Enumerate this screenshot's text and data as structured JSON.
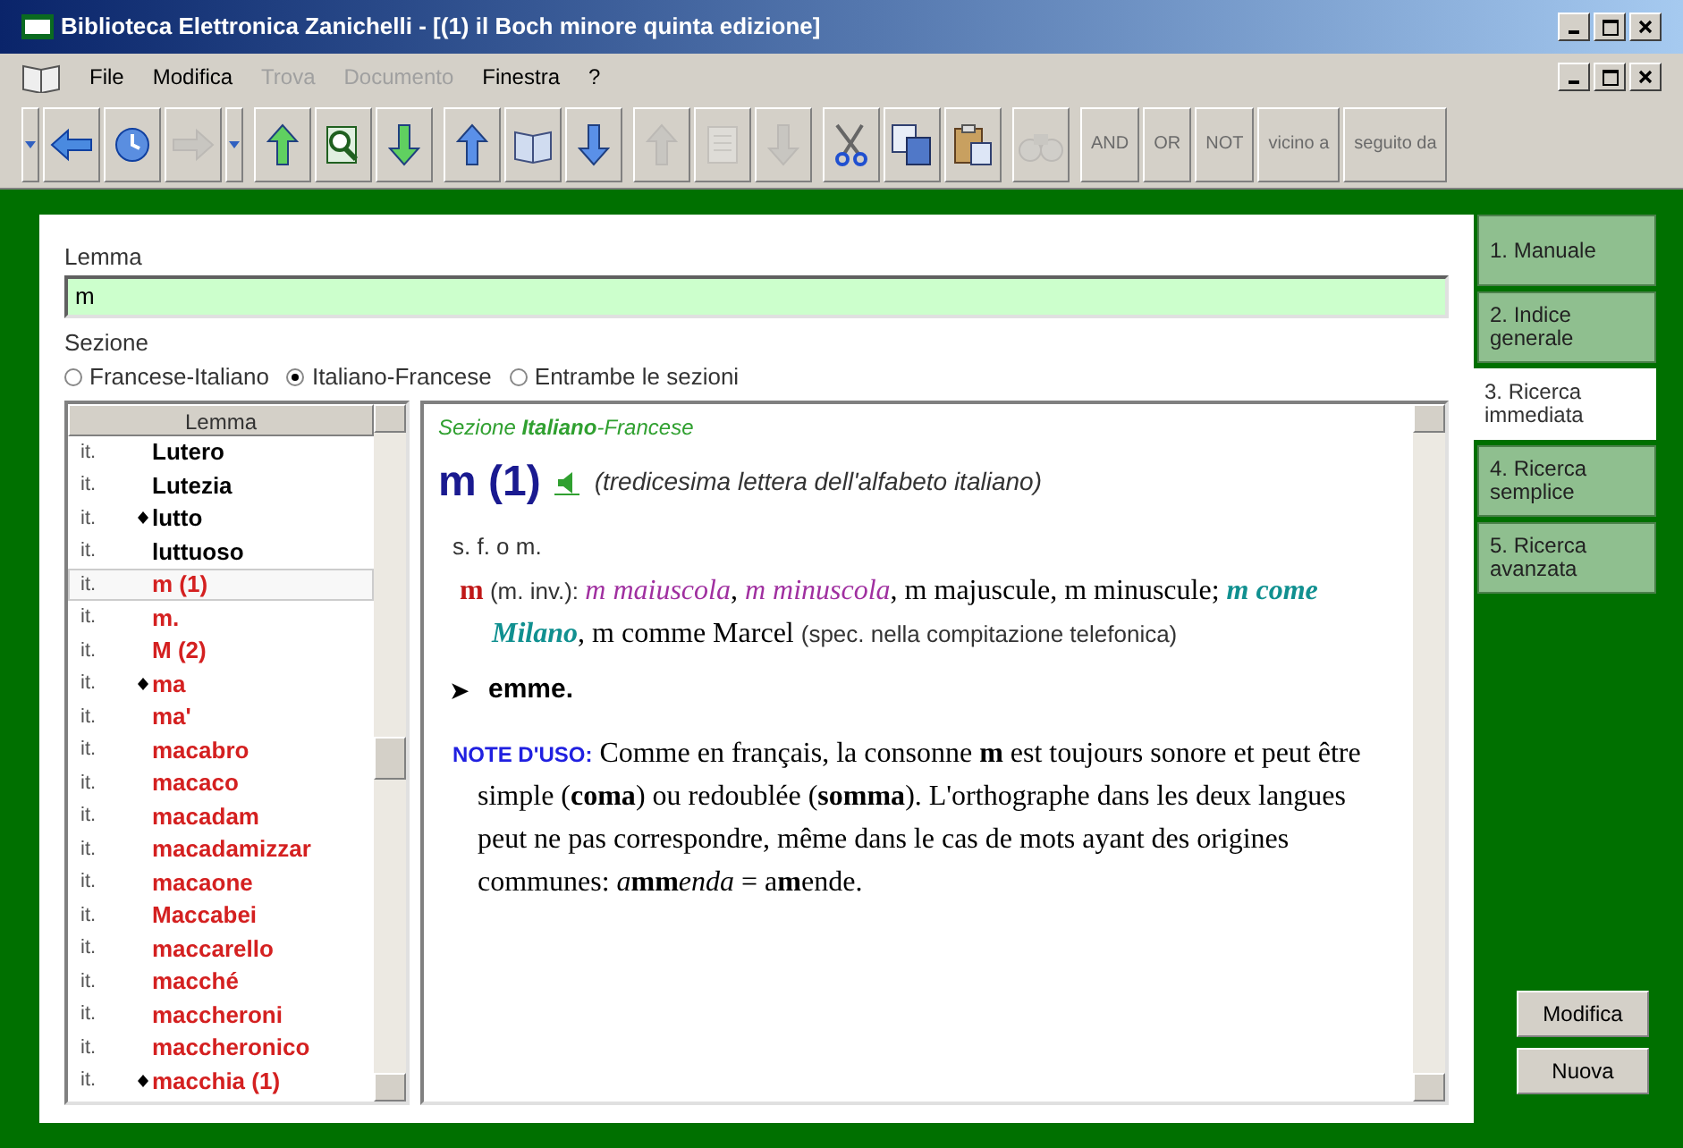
{
  "window": {
    "title": "Biblioteca Elettronica Zanichelli - [(1) il Boch minore quinta edizione]"
  },
  "menu": [
    {
      "label": "File",
      "disabled": false
    },
    {
      "label": "Modifica",
      "disabled": false
    },
    {
      "label": "Trova",
      "disabled": true
    },
    {
      "label": "Documento",
      "disabled": true
    },
    {
      "label": "Finestra",
      "disabled": false
    },
    {
      "label": "?",
      "disabled": false
    }
  ],
  "toolbar": {
    "groups": [
      [
        {
          "kind": "caret",
          "disabled": false
        },
        {
          "kind": "back",
          "disabled": false
        },
        {
          "kind": "history",
          "disabled": false
        },
        {
          "kind": "forward",
          "disabled": true
        },
        {
          "kind": "caret",
          "disabled": false
        }
      ],
      [
        {
          "kind": "up",
          "disabled": false
        },
        {
          "kind": "find",
          "disabled": false
        },
        {
          "kind": "down",
          "disabled": false
        }
      ],
      [
        {
          "kind": "up",
          "disabled": false
        },
        {
          "kind": "book",
          "disabled": false
        },
        {
          "kind": "down",
          "disabled": false
        }
      ],
      [
        {
          "kind": "up",
          "disabled": true
        },
        {
          "kind": "page",
          "disabled": true
        },
        {
          "kind": "down",
          "disabled": true
        }
      ],
      [
        {
          "kind": "cut",
          "disabled": false
        },
        {
          "kind": "copy",
          "disabled": false
        },
        {
          "kind": "paste",
          "disabled": false
        }
      ],
      [
        {
          "kind": "binoculars",
          "disabled": true
        }
      ]
    ],
    "operators": [
      {
        "label": "AND",
        "disabled": true
      },
      {
        "label": "OR",
        "disabled": true
      },
      {
        "label": "NOT",
        "disabled": true
      },
      {
        "label": "vicino a",
        "disabled": true
      },
      {
        "label": "seguito da",
        "disabled": true
      }
    ]
  },
  "search": {
    "label": "Lemma",
    "value": "m"
  },
  "section": {
    "label": "Sezione",
    "options": [
      {
        "label": "Francese-Italiano",
        "selected": false
      },
      {
        "label": "Italiano-Francese",
        "selected": true
      },
      {
        "label": "Entrambe le sezioni",
        "selected": false
      }
    ]
  },
  "lemma_list": {
    "header": "Lemma",
    "rows": [
      {
        "lang": "it.",
        "word": "Lutero",
        "marker": false,
        "color": "#000000",
        "selected": false
      },
      {
        "lang": "it.",
        "word": "Lutezia",
        "marker": false,
        "color": "#000000",
        "selected": false
      },
      {
        "lang": "it.",
        "word": "lutto",
        "marker": true,
        "color": "#000000",
        "selected": false
      },
      {
        "lang": "it.",
        "word": "luttuoso",
        "marker": false,
        "color": "#000000",
        "selected": false
      },
      {
        "lang": "it.",
        "word": "m (1)",
        "marker": false,
        "color": "#d42020",
        "selected": true
      },
      {
        "lang": "it.",
        "word": "m.",
        "marker": false,
        "color": "#d42020",
        "selected": false
      },
      {
        "lang": "it.",
        "word": "M (2)",
        "marker": false,
        "color": "#d42020",
        "selected": false
      },
      {
        "lang": "it.",
        "word": "ma",
        "marker": true,
        "color": "#d42020",
        "selected": false
      },
      {
        "lang": "it.",
        "word": "ma'",
        "marker": false,
        "color": "#d42020",
        "selected": false
      },
      {
        "lang": "it.",
        "word": "macabro",
        "marker": false,
        "color": "#d42020",
        "selected": false
      },
      {
        "lang": "it.",
        "word": "macaco",
        "marker": false,
        "color": "#d42020",
        "selected": false
      },
      {
        "lang": "it.",
        "word": "macadam",
        "marker": false,
        "color": "#d42020",
        "selected": false
      },
      {
        "lang": "it.",
        "word": "macadamizzar",
        "marker": false,
        "color": "#d42020",
        "selected": false
      },
      {
        "lang": "it.",
        "word": "macaone",
        "marker": false,
        "color": "#d42020",
        "selected": false
      },
      {
        "lang": "it.",
        "word": "Maccabei",
        "marker": false,
        "color": "#d42020",
        "selected": false
      },
      {
        "lang": "it.",
        "word": "maccarello",
        "marker": false,
        "color": "#d42020",
        "selected": false
      },
      {
        "lang": "it.",
        "word": "macché",
        "marker": false,
        "color": "#d42020",
        "selected": false
      },
      {
        "lang": "it.",
        "word": "maccheroni",
        "marker": false,
        "color": "#d42020",
        "selected": false
      },
      {
        "lang": "it.",
        "word": "maccheronico",
        "marker": false,
        "color": "#d42020",
        "selected": false
      },
      {
        "lang": "it.",
        "word": "macchia (1)",
        "marker": true,
        "color": "#d42020",
        "selected": false
      }
    ]
  },
  "entry": {
    "section": "Sezione **Italiano**-Francese",
    "headword": "m (1)",
    "gloss": "(tredicesima lettera dell'alfabeto italiano)",
    "grammar": "s. f. o m.",
    "sense": [
      {
        "kind": "head",
        "text": "m"
      },
      {
        "kind": "label",
        "text": " (m. inv.): "
      },
      {
        "kind": "example",
        "text": "m maiuscola"
      },
      {
        "kind": "serif",
        "text": ", "
      },
      {
        "kind": "example",
        "text": "m minuscola"
      },
      {
        "kind": "serif",
        "text": ", m majuscule, m minuscule; "
      },
      {
        "kind": "phrase",
        "text": "m come Milano"
      },
      {
        "kind": "serif",
        "text": ", m comme Marcel "
      },
      {
        "kind": "label",
        "text": "(spec. nella compitazione telefonica)"
      }
    ],
    "arrow": "➤",
    "translation": "emme.",
    "note_label": "NOTE D'USO:",
    "note": [
      {
        "kind": "serif",
        "text": "Comme en français, la consonne "
      },
      {
        "kind": "bold",
        "text": "m"
      },
      {
        "kind": "serif",
        "text": " est toujours sonore et peut être simple ("
      },
      {
        "kind": "bold",
        "text": "coma"
      },
      {
        "kind": "serif",
        "text": ") ou redoublée ("
      },
      {
        "kind": "bold",
        "text": "somma"
      },
      {
        "kind": "serif",
        "text": "). L'orthographe dans les deux langues peut ne pas correspondre, même dans le cas de mots ayant des origines communes: "
      },
      {
        "kind": "italic",
        "text": "a"
      },
      {
        "kind": "bold",
        "text": "mm"
      },
      {
        "kind": "italic",
        "text": "enda"
      },
      {
        "kind": "serif",
        "text": " = a"
      },
      {
        "kind": "bold",
        "text": "m"
      },
      {
        "kind": "serif",
        "text": "ende."
      }
    ]
  },
  "side_tabs": [
    {
      "label": "1. Manuale",
      "selected": false
    },
    {
      "label": "2. Indice generale",
      "selected": false
    },
    {
      "label": "3. Ricerca immediata",
      "selected": true
    },
    {
      "label": "4. Ricerca semplice",
      "selected": false
    },
    {
      "label": "5. Ricerca avanzata",
      "selected": false
    }
  ],
  "buttons": [
    {
      "label": "Modifica"
    },
    {
      "label": "Nuova"
    }
  ]
}
